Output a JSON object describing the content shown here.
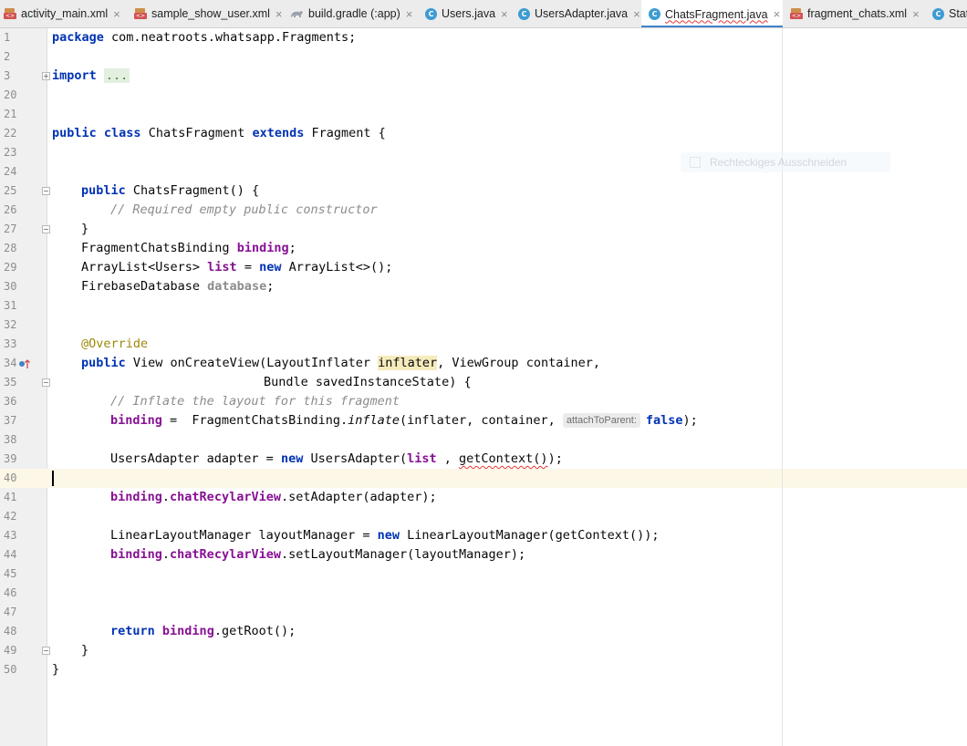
{
  "tabs": [
    {
      "label": "activity_main.xml",
      "icon": "xml-file-icon",
      "closable": false
    },
    {
      "label": "sample_show_user.xml",
      "icon": "xml-file-icon",
      "closable": true
    },
    {
      "label": "build.gradle (:app)",
      "icon": "gradle-icon",
      "closable": true
    },
    {
      "label": "Users.java",
      "icon": "java-class-icon",
      "closable": true
    },
    {
      "label": "UsersAdapter.java",
      "icon": "java-class-icon",
      "closable": true
    },
    {
      "label": "ChatsFragment.java",
      "icon": "java-class-icon",
      "closable": true,
      "active": true
    },
    {
      "label": "fragment_chats.xml",
      "icon": "xml-file-icon",
      "closable": true
    },
    {
      "label": "Stat",
      "icon": "java-class-icon",
      "closable": false
    }
  ],
  "tab_close_glyph": "×",
  "line_numbers": [
    "1",
    "2",
    "3",
    "20",
    "21",
    "22",
    "23",
    "24",
    "25",
    "26",
    "27",
    "28",
    "29",
    "30",
    "31",
    "32",
    "33",
    "34",
    "35",
    "36",
    "37",
    "38",
    "39",
    "40",
    "41",
    "42",
    "43",
    "44",
    "45",
    "46",
    "47",
    "48",
    "49",
    "50"
  ],
  "code": {
    "l1": {
      "kw": "package",
      "rest": " com.neatroots.whatsapp.Fragments;"
    },
    "l3": {
      "kw": "import",
      "dots": "..."
    },
    "l22": {
      "kw1": "public",
      "kw2": "class",
      "name": " ChatsFragment ",
      "kw3": "extends",
      "rest": " Fragment {"
    },
    "l25": {
      "kw": "public",
      "rest": " ChatsFragment() {"
    },
    "l26": {
      "comment": "// Required empty public constructor"
    },
    "l27": {
      "text": "}"
    },
    "l28": {
      "type": "FragmentChatsBinding ",
      "field": "binding",
      "end": ";"
    },
    "l29": {
      "type": "ArrayList<Users> ",
      "field": "list",
      "mid": " = ",
      "kw": "new",
      "rest": " ArrayList<>();"
    },
    "l30": {
      "type": "FirebaseDatabase ",
      "field": "database",
      "end": ";"
    },
    "l33": {
      "annotation": "@Override"
    },
    "l34": {
      "kw": "public",
      "pre": " View onCreateView(LayoutInflater ",
      "var": "inflater",
      "post": ", ViewGroup container,"
    },
    "l35": {
      "text": "Bundle savedInstanceState) {"
    },
    "l36": {
      "comment": "// Inflate the layout for this fragment"
    },
    "l37": {
      "field": "binding",
      "mid": " =  FragmentChatsBinding.",
      "method": "inflate",
      "args": "(inflater, container, ",
      "hint": "attachToParent:",
      "kw": "false",
      "end": ");"
    },
    "l39": {
      "pre": "UsersAdapter adapter = ",
      "kw": "new",
      "mid": " UsersAdapter(",
      "field": "list",
      "sep": " , ",
      "err": "getContext()",
      "end": ");"
    },
    "l41": {
      "field1": "binding",
      "dot": ".",
      "field2": "chatRecylarView",
      "rest": ".setAdapter(adapter);"
    },
    "l43": {
      "pre": "LinearLayoutManager layoutManager = ",
      "kw": "new",
      "rest": " LinearLayoutManager(getContext());"
    },
    "l44": {
      "field1": "binding",
      "dot": ".",
      "field2": "chatRecylarView",
      "rest": ".setLayoutManager(layoutManager);"
    },
    "l48": {
      "kw": "return",
      "sp": " ",
      "field": "binding",
      "rest": ".getRoot();"
    },
    "l49": {
      "text": "}"
    },
    "l50": {
      "text": "}"
    }
  },
  "faded_tooltip": {
    "label": "Rechteckiges Ausschneiden",
    "icon": "rectangle-icon"
  },
  "colors": {
    "keyword": "#0033b3",
    "field": "#871094",
    "comment": "#8c8c8c",
    "annotation": "#9e880d",
    "active_tab_accent": "#4083c9",
    "caret_line": "#fcf7e6"
  }
}
